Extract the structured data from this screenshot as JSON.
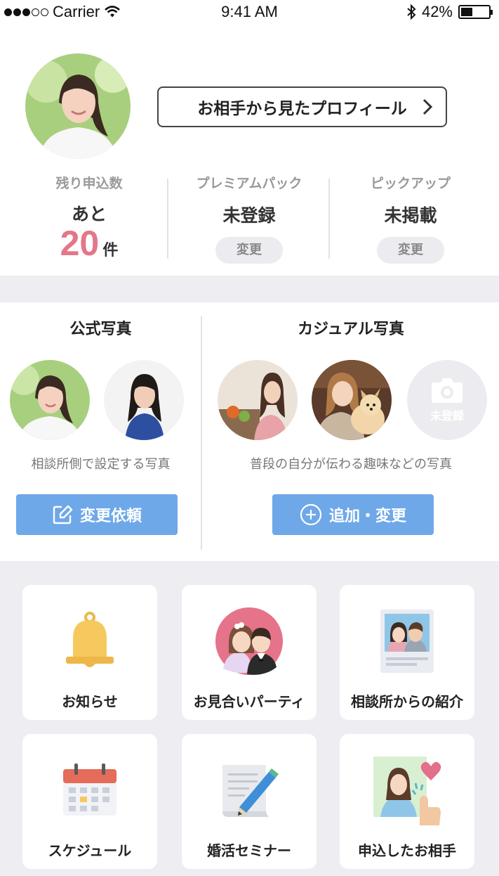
{
  "status_bar": {
    "carrier": "Carrier",
    "time": "9:41 AM",
    "battery": "42%",
    "battery_level": 0.42
  },
  "profile": {
    "view_profile_button": "お相手から見たプロフィール",
    "stats": [
      {
        "label": "残り申込数",
        "prefix": "あと",
        "number": "20",
        "unit": "件"
      },
      {
        "label": "プレミアムパック",
        "value": "未登録",
        "button": "変更"
      },
      {
        "label": "ピックアップ",
        "value": "未掲載",
        "button": "変更"
      }
    ]
  },
  "photos": {
    "official": {
      "title": "公式写真",
      "caption": "相談所側で設定する写真",
      "button": "変更依頼"
    },
    "casual": {
      "title": "カジュアル写真",
      "caption": "普段の自分が伝わる趣味などの写真",
      "button": "追加・変更",
      "unregistered": "未登録"
    }
  },
  "menu": [
    {
      "label": "お知らせ",
      "icon": "bell-icon"
    },
    {
      "label": "お見合いパーティ",
      "icon": "couple-icon"
    },
    {
      "label": "相談所からの紹介",
      "icon": "introduction-icon"
    },
    {
      "label": "スケジュール",
      "icon": "calendar-icon"
    },
    {
      "label": "婚活セミナー",
      "icon": "seminar-icon"
    },
    {
      "label": "申込したお相手",
      "icon": "applied-partner-icon"
    }
  ]
}
